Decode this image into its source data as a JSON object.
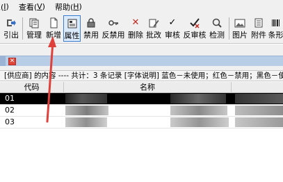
{
  "menu": [
    {
      "label": "息(",
      "accel": "I",
      "suffix": ")"
    },
    {
      "label": "查看(",
      "accel": "V",
      "suffix": ")"
    },
    {
      "label": "帮助(",
      "accel": "H",
      "suffix": ")"
    }
  ],
  "toolbar": [
    {
      "label": "引出",
      "icon": "export-icon"
    },
    {
      "label": "管理",
      "icon": "manage-icon"
    },
    {
      "label": "新增",
      "icon": "new-document-icon"
    },
    {
      "label": "属性",
      "icon": "properties-icon",
      "active": true
    },
    {
      "label": "禁用",
      "icon": "lock-icon"
    },
    {
      "label": "反禁用",
      "icon": "key-icon"
    },
    {
      "label": "删除",
      "icon": "delete-x-icon"
    },
    {
      "label": "批改",
      "icon": "edit-pencil-icon"
    },
    {
      "label": "审核",
      "icon": "checkmark-icon"
    },
    {
      "label": "反审核",
      "icon": "uncheck-icon"
    },
    {
      "label": "检测",
      "icon": "detect-icon"
    },
    {
      "label": "图片",
      "icon": "picture-icon"
    },
    {
      "label": "附件",
      "icon": "attachment-icon"
    },
    {
      "label": "条形",
      "icon": "barcode-icon"
    }
  ],
  "info_bar": "[供应商] 的内容 ---- 共计：3 条记录 [字体说明] 蓝色－未使用；红色－禁用；黑色－使用",
  "table": {
    "columns": [
      "代码",
      "名称"
    ],
    "rows": [
      {
        "code": "01",
        "selected": true
      },
      {
        "code": "02",
        "selected": false
      },
      {
        "code": "03",
        "selected": false
      }
    ]
  },
  "colors": {
    "accent": "#3b7bd4",
    "annotation_arrow": "#e0403a",
    "close_tab": "#e0453a",
    "selected_row": "#000000"
  }
}
